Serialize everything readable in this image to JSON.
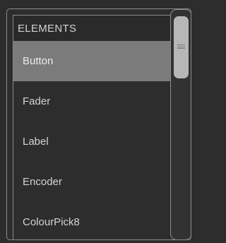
{
  "panel": {
    "header": "ELEMENTS",
    "items": [
      {
        "label": "Button",
        "selected": true
      },
      {
        "label": "Fader",
        "selected": false
      },
      {
        "label": "Label",
        "selected": false
      },
      {
        "label": "Encoder",
        "selected": false
      },
      {
        "label": "ColourPick8",
        "selected": false
      }
    ],
    "scrollbar": {
      "icon": "grip-icon"
    }
  },
  "colors": {
    "background": "#2d2d2d",
    "border": "#8c8c8c",
    "selected_row": "#7b7b7b",
    "text": "#d4d4d4",
    "thumb": "#b7b7b7"
  }
}
